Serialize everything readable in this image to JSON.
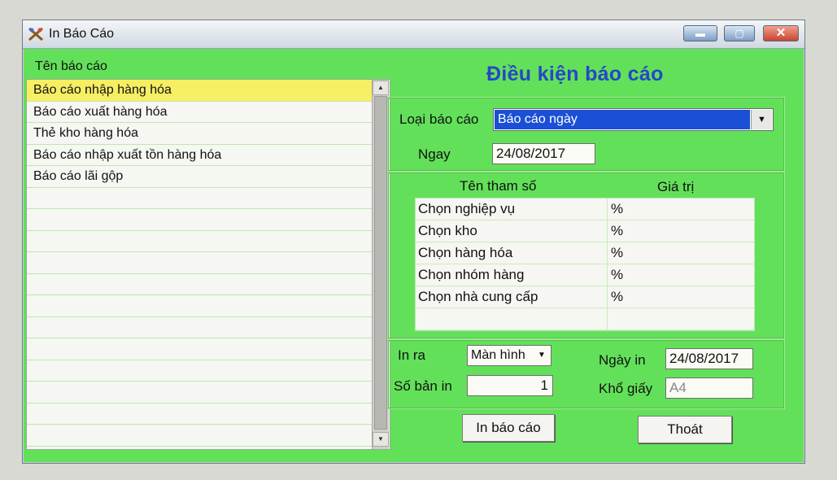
{
  "window": {
    "title": "In Báo Cáo",
    "controls": {
      "minimize": "▬",
      "maximize": "▢",
      "close": "✕"
    }
  },
  "report_list": {
    "header": "Tên báo cáo",
    "items": [
      "Báo cáo nhập hàng hóa",
      "Báo cáo xuất hàng hóa",
      "Thẻ kho hàng hóa",
      "Báo cáo nhập xuất tồn hàng hóa",
      "Báo cáo lãi gộp",
      "",
      "",
      "",
      "",
      "",
      "",
      "",
      "",
      "",
      "",
      "",
      ""
    ],
    "selected_index": 0
  },
  "conditions": {
    "heading": "Điều kiện báo cáo",
    "report_type_label": "Loại báo cáo",
    "report_type_value": "Báo cáo ngày",
    "date_label": "Ngay",
    "date_value": "24/08/2017"
  },
  "params": {
    "col_name": "Tên tham số",
    "col_value": "Giá trị",
    "rows": [
      {
        "name": "Chọn nghiệp vụ",
        "value": "%"
      },
      {
        "name": "Chọn kho",
        "value": "%"
      },
      {
        "name": "Chọn hàng hóa",
        "value": "%"
      },
      {
        "name": "Chọn nhóm hàng",
        "value": "%"
      },
      {
        "name": "Chọn nhà cung cấp",
        "value": "%"
      },
      {
        "name": "",
        "value": ""
      }
    ]
  },
  "print": {
    "output_label": "In ra",
    "output_value": "Màn hình",
    "copies_label": "Số bản in",
    "copies_value": "1",
    "print_date_label": "Ngày in",
    "print_date_value": "24/08/2017",
    "paper_label": "Khổ giấy",
    "paper_value": "A4"
  },
  "actions": {
    "print_button": "In báo cáo",
    "exit_button": "Thoát"
  },
  "colors": {
    "window_bg": "#63e05a",
    "selection": "#f7ef63",
    "heading": "#2647c8",
    "combo_highlight": "#1a4fd6"
  }
}
